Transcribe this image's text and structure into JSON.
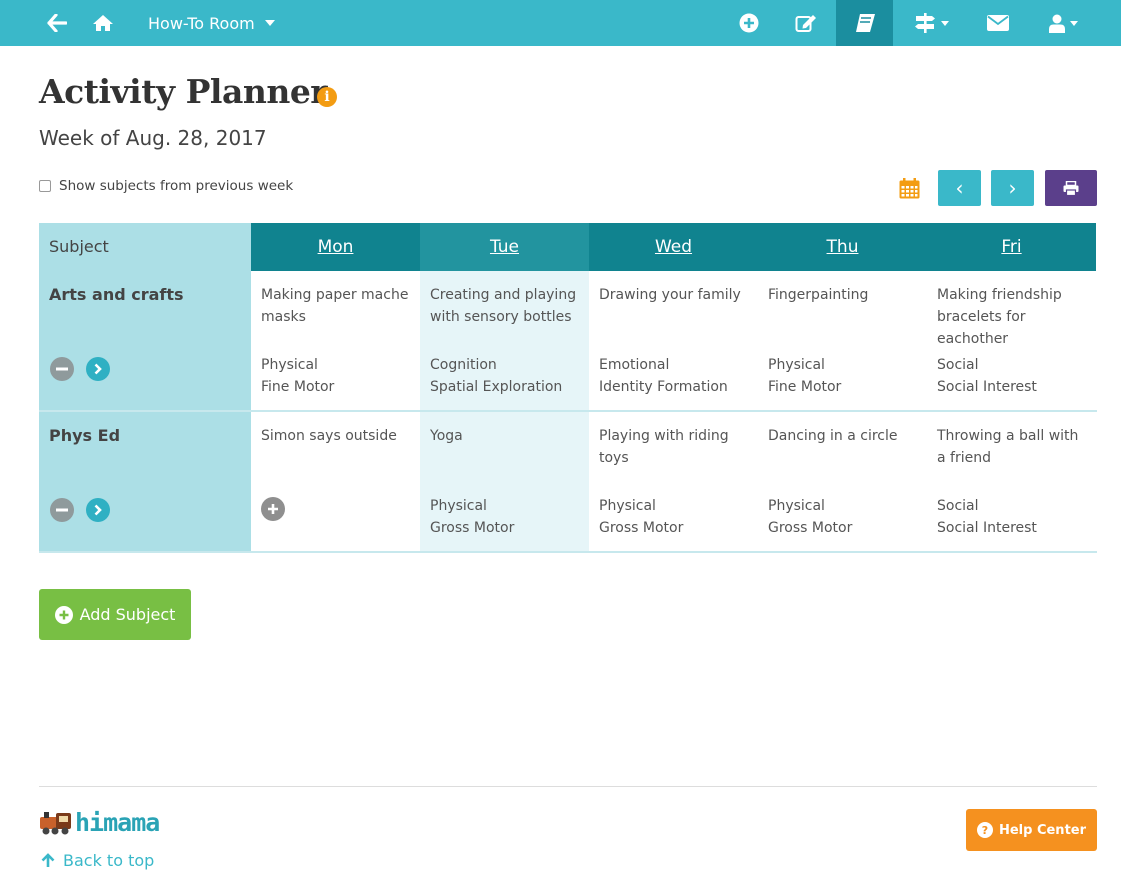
{
  "nav": {
    "room_name": "How-To Room",
    "icons": [
      "back-arrow-icon",
      "home-icon",
      "add-circle-icon",
      "edit-icon",
      "book-icon",
      "signpost-icon",
      "envelope-icon",
      "user-icon"
    ]
  },
  "header": {
    "title": "Activity Planner",
    "info_glyph": "i",
    "week_label": "Week of Aug. 28, 2017",
    "show_previous_label": "Show subjects from previous week"
  },
  "toolbar": {
    "prev_glyph": "‹",
    "next_glyph": "›"
  },
  "table": {
    "subject_header": "Subject",
    "days": [
      "Mon",
      "Tue",
      "Wed",
      "Thu",
      "Fri"
    ],
    "highlight_day": "Tue",
    "rows": [
      {
        "subject": "Arts and crafts",
        "cells": [
          {
            "activity": "Making paper mache masks",
            "tags": [
              "Physical",
              "Fine Motor"
            ]
          },
          {
            "activity": "Creating and playing with sensory bottles",
            "tags": [
              "Cognition",
              "Spatial Exploration"
            ]
          },
          {
            "activity": "Drawing your family",
            "tags": [
              "Emotional",
              "Identity Formation"
            ]
          },
          {
            "activity": "Fingerpainting",
            "tags": [
              "Physical",
              "Fine Motor"
            ]
          },
          {
            "activity": "Making friendship bracelets for eachother",
            "tags": [
              "Social",
              "Social Interest"
            ]
          }
        ]
      },
      {
        "subject": "Phys Ed",
        "cells": [
          {
            "activity": "Simon says outside",
            "tags": [],
            "show_add": true
          },
          {
            "activity": "Yoga",
            "tags": [
              "Physical",
              "Gross Motor"
            ]
          },
          {
            "activity": "Playing with riding toys",
            "tags": [
              "Physical",
              "Gross Motor"
            ]
          },
          {
            "activity": "Dancing in a circle",
            "tags": [
              "Physical",
              "Gross Motor"
            ]
          },
          {
            "activity": "Throwing a ball with a friend",
            "tags": [
              "Social",
              "Social Interest"
            ]
          }
        ]
      }
    ]
  },
  "actions": {
    "add_subject_label": "Add Subject"
  },
  "footer": {
    "logo_text": "himama",
    "back_to_top": "Back to top",
    "help_center": "Help Center",
    "help_glyph": "?"
  },
  "colors": {
    "nav": "#3ab8c9",
    "nav_active": "#1b8e9f",
    "table_header": "#10838f",
    "subject_col": "#acdfe6",
    "add_subject": "#78bf44",
    "help_center": "#f5911f",
    "print_button": "#5b3f8b",
    "info": "#f39c12"
  }
}
